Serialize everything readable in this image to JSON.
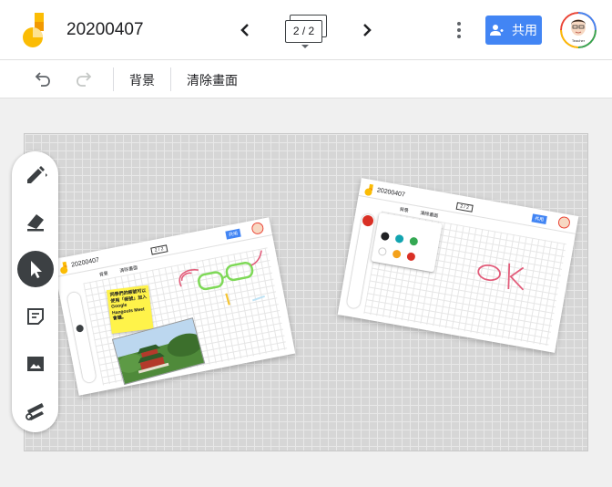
{
  "app": {
    "title": "20200407",
    "frame_indicator": "2 / 2",
    "share_label": "共用",
    "avatar_caption": "Teacher"
  },
  "toolbar": {
    "background_label": "背景",
    "clear_label": "清除畫面"
  },
  "tools": [
    "pen-tool",
    "eraser-tool",
    "select-tool",
    "sticky-note-tool",
    "image-tool",
    "laser-tool"
  ],
  "active_tool": "select-tool",
  "colors": {
    "accent": "#4285f4",
    "logo_yellow": "#fbbc04",
    "logo_orange": "#f29900",
    "sticky": "#fff34a",
    "ink_green": "#7ed957",
    "ink_red": "#e25c7a"
  },
  "card_left": {
    "title": "20200407",
    "frame_indicator": "2 / 2",
    "share_label": "共用",
    "background_label": "背景",
    "clear_label": "清除畫面",
    "sticky_text": "同學們的帳號可以使用「帳號」加入Google Hangouts Meet會議。"
  },
  "card_right": {
    "title": "20200407",
    "frame_indicator": "2 / 2",
    "share_label": "共用",
    "background_label": "背景",
    "clear_label": "清除畫面",
    "palette_colors": [
      "#202124",
      "#12a4b0",
      "#34a853",
      "#ffffff",
      "#f4a11a",
      "#d93025"
    ]
  }
}
